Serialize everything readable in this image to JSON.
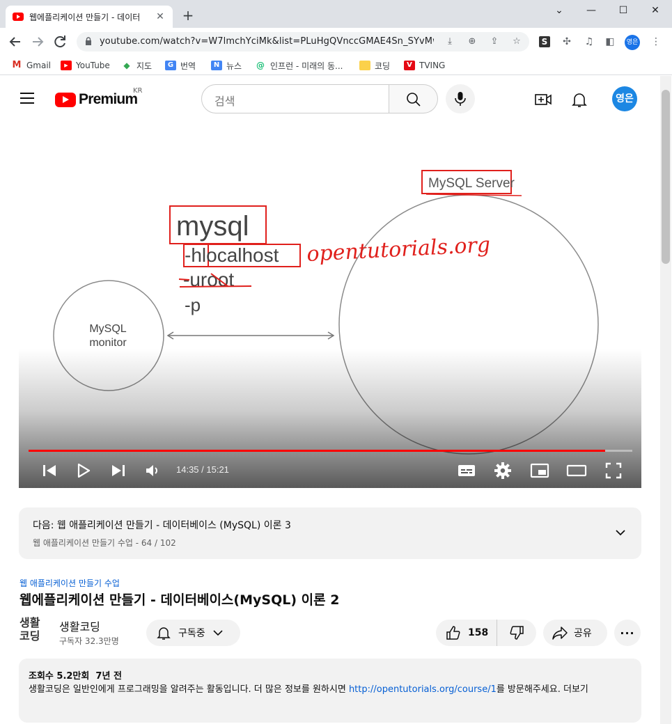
{
  "browser": {
    "tab_title": "웹에플리케이션 만들기 - 데이터",
    "tab_close": "✕",
    "new_tab": "+",
    "window_controls": {
      "minimize": "—",
      "maximize": "☐",
      "close": "✕",
      "menu": "⌄"
    },
    "url": "youtube.com/watch?v=W7lmchYciMk&list=PLuHgQVnccGMAE4Sn_SYvMw...",
    "extension_s": "S",
    "profile_label": "영은",
    "bookmarks": [
      {
        "label": "Gmail",
        "icon": "gmail-icon",
        "color": "#d93025",
        "glyph": "M"
      },
      {
        "label": "YouTube",
        "icon": "youtube-icon",
        "color": "#ff0000",
        "glyph": "▶"
      },
      {
        "label": "지도",
        "icon": "maps-icon",
        "color": "#34a853",
        "glyph": "◆"
      },
      {
        "label": "번역",
        "icon": "translate-icon",
        "color": "#4285f4",
        "glyph": "G"
      },
      {
        "label": "뉴스",
        "icon": "news-icon",
        "color": "#4285f4",
        "glyph": "N"
      },
      {
        "label": "인프런 - 미래의 동...",
        "icon": "inflearn-icon",
        "color": "#1dc078",
        "glyph": "@"
      },
      {
        "label": "코딩",
        "icon": "folder-icon",
        "color": "#fbd14b",
        "glyph": ""
      },
      {
        "label": "TVING",
        "icon": "tving-icon",
        "color": "#e50914",
        "glyph": "V"
      }
    ]
  },
  "youtube": {
    "logo_text": "Premium",
    "logo_region": "KR",
    "search_placeholder": "검색",
    "avatar_label": "영은"
  },
  "video": {
    "slide": {
      "server_label": "MySQL Server",
      "command": "mysql",
      "host_flag": "-hlocalhost",
      "user_flag": "-uroot",
      "pass_flag": "-p",
      "handwritten_note": "opentutorials.org",
      "client_label_line1": "MySQL",
      "client_label_line2": "monitor"
    },
    "current_time": "14:35",
    "duration": "15:21",
    "time_display": "14:35 / 15:21",
    "progress_fraction": 0.955
  },
  "up_next": {
    "title": "다음: 웹 애플리케이션 만들기 - 데이터베이스 (MySQL) 이론 3",
    "subtitle": "웹 애플리케이션 만들기 수업 - 64 / 102"
  },
  "video_info": {
    "playlist_link": "웹 애플리케이션 만들기 수업",
    "title": "웹에플리케이션 만들기 - 데이터베이스(MySQL) 이론 2",
    "channel_logo_line1": "생활",
    "channel_logo_line2": "코딩",
    "channel_name": "생활코딩",
    "subscribers": "구독자 32.3만명",
    "subscribe_label": "구독중",
    "like_count": "158",
    "share_label": "공유",
    "more_label": "···"
  },
  "description": {
    "views": "조회수 5.2만회",
    "age": "7년 전",
    "text_before_link": "생활코딩은 일반인에게 프로그래밍을 알려주는 활동입니다. 더 많은 정보를 원하시면 ",
    "link": "http://opentutorials.org/course/1",
    "text_after_link": "를 방문해주세요.",
    "more": "더보기"
  },
  "colors": {
    "yt_red": "#ff0000",
    "link_blue": "#065fd4",
    "annotation_red": "#e0201c"
  }
}
